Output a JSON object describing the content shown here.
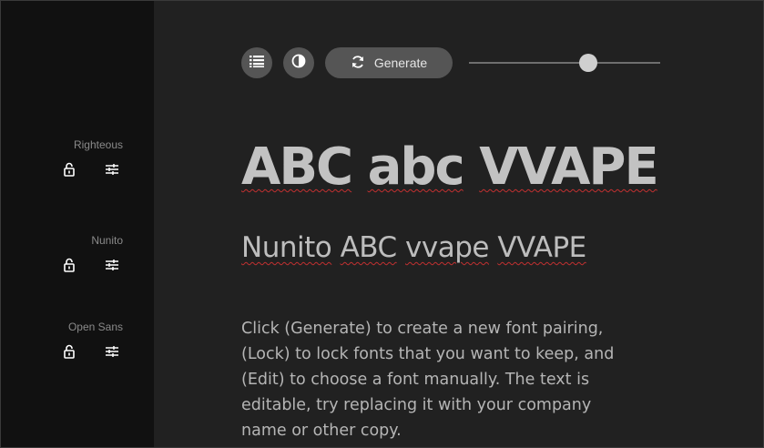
{
  "sidebar": {
    "fonts": [
      {
        "name": "Righteous",
        "lock_icon": "unlock-icon",
        "edit_icon": "sliders-icon"
      },
      {
        "name": "Nunito",
        "lock_icon": "unlock-icon",
        "edit_icon": "sliders-icon"
      },
      {
        "name": "Open Sans",
        "lock_icon": "unlock-icon",
        "edit_icon": "sliders-icon"
      }
    ]
  },
  "toolbar": {
    "list_icon": "list-icon",
    "contrast_icon": "contrast-icon",
    "generate_label": "Generate",
    "generate_icon": "refresh-icon",
    "slider_value": 0.625
  },
  "preview": {
    "heading_words": [
      "ABC",
      "abc",
      "VVAPE"
    ],
    "subheading_words": [
      "Nunito",
      "ABC",
      "vvape",
      "VVAPE"
    ],
    "body": "Click (Generate) to create a new font pairing, (Lock) to lock fonts that you want to keep, and (Edit) to choose a font manually. The text is editable, try replacing it with your company name or other copy."
  },
  "colors": {
    "background": "#212121",
    "sidebar": "#111111",
    "button": "#555555",
    "spellcheck": "#c23030"
  }
}
